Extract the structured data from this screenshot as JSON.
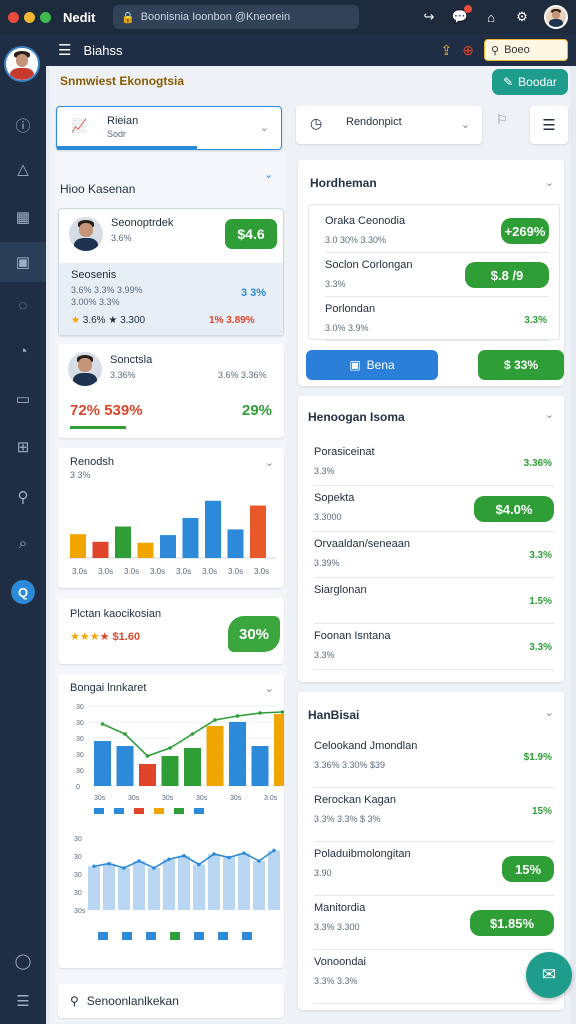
{
  "window": {
    "app_name": "Nedit",
    "url": "Boonisnia Ioonbon @Kneorein",
    "dots": [
      "#e84b3c",
      "#f1b733",
      "#3fb950"
    ]
  },
  "header": {
    "title": "Biahss",
    "search_label": "Boeo"
  },
  "page": {
    "title": "Snmwiest Ekonogtsia",
    "action_button": "Boodar"
  },
  "top_filters": {
    "left": {
      "title": "Rieian",
      "sub": "Sodr"
    },
    "right": {
      "title": "Rendonpict"
    }
  },
  "left_column": {
    "section_title": "Hioo Kasenan",
    "user_card1": {
      "name": "Seonoptrdek",
      "sub": "3.6%",
      "amount": "$4.6",
      "detail_title": "Seosenis",
      "detail_line1": "3.6% 3.3% 3.99%",
      "detail_line2": "3.00% 3.3%",
      "detail_pct": "3 3%",
      "foot_left": "3.6% ★ 3.300",
      "foot_right": "1% 3.89%"
    },
    "user_card2": {
      "name": "Sonctsla",
      "sub": "3.36%",
      "sub_right": "3.6% 3.36%",
      "big_left": "72% 539%",
      "big_right": "29%"
    },
    "chart1": {
      "title": "Renodsh",
      "sub": "3 3%"
    },
    "promo": {
      "title": "Plctan kaocikosian",
      "price": "$1.60",
      "badge": "30%"
    },
    "chart2": {
      "title": "Bongai lnnkaret"
    },
    "bottom_search": "Senoonlanlkekan"
  },
  "right_column": {
    "section1": {
      "title": "Hordheman",
      "rows": [
        {
          "title": "Oraka Ceonodia",
          "sub": "3.0 30%    3.30%",
          "badge": "+269%"
        },
        {
          "title": "Soclon Corlongan",
          "sub": "3.3%",
          "badge": "$.8 /9"
        },
        {
          "title": "Porlondan",
          "sub": "3.0% 3.9%",
          "badge": "3.3%"
        }
      ],
      "button_blue": "Bena",
      "button_green": "$ 33%"
    },
    "section2": {
      "title": "Henoogan Isoma",
      "rows": [
        {
          "title": "Porasiceinat",
          "sub": "3.3%",
          "badge": "3.36%"
        },
        {
          "title": "Sopekta",
          "sub": "3.3000",
          "badge": "$4.0%"
        },
        {
          "title": "Orvaaldan/seneaan",
          "sub": "3.39%",
          "badge": "3.3%"
        },
        {
          "title": "Siarglonan",
          "sub": "",
          "badge": "1.5%"
        },
        {
          "title": "Foonan Isntana",
          "sub": "3.3%",
          "badge": "3.3%"
        }
      ]
    },
    "section3": {
      "title": "HanBisai",
      "rows": [
        {
          "title": "Celookand Jmondlan",
          "sub": "3.36%    3.30%   $39",
          "badge": "$1.9%"
        },
        {
          "title": "Rerockan Kagan",
          "sub": "3.3%   3.3%   $ 3%",
          "badge": "15%"
        },
        {
          "title": "Poladuibmolongitan",
          "sub": "3.90",
          "badge": "15%"
        },
        {
          "title": "Manitordia",
          "sub": "3.3%  3.300",
          "badge": "$1.85%"
        },
        {
          "title": "Vonoondai",
          "sub": "3.3% 3.3%",
          "badge": "3.3%"
        }
      ]
    }
  },
  "chart_data": [
    {
      "type": "bar",
      "title": "Renodsh",
      "categories": [
        "3.0s",
        "3.0s",
        "3.0s",
        "3.0s",
        "3.0s",
        "3.0s",
        "3.0s",
        "3.0s"
      ],
      "values": [
        25,
        17,
        33,
        16,
        24,
        42,
        60,
        30,
        55
      ],
      "colors": [
        "#f0a500",
        "#e0452b",
        "#2f9e37",
        "#f0a500",
        "#2c8ad8",
        "#2c8ad8",
        "#2c8ad8",
        "#2c8ad8",
        "#e8582a"
      ]
    },
    {
      "type": "bar",
      "title": "Bongai lnnkaret",
      "yticks": [
        "0",
        "30",
        "30",
        "30",
        "30",
        "30"
      ],
      "categories": [
        "30s",
        "30s",
        "30s",
        "30s",
        "30s",
        "3.0s"
      ],
      "values": [
        45,
        40,
        22,
        30,
        38,
        60,
        64,
        40,
        72
      ],
      "line": [
        62,
        52,
        30,
        38,
        52,
        66,
        70,
        73,
        74
      ],
      "colors": [
        "#2c8ad8",
        "#2c8ad8",
        "#e0452b",
        "#2f9e37",
        "#2f9e37",
        "#f0a500",
        "#2c8ad8",
        "#2c8ad8",
        "#f0a500"
      ]
    },
    {
      "type": "area",
      "yticks": [
        "30s",
        "30",
        "30",
        "30",
        "30"
      ],
      "values": [
        50,
        53,
        48,
        56,
        48,
        58,
        62,
        52,
        64,
        60,
        65,
        56,
        68
      ],
      "color": "#2c8ad8"
    }
  ]
}
